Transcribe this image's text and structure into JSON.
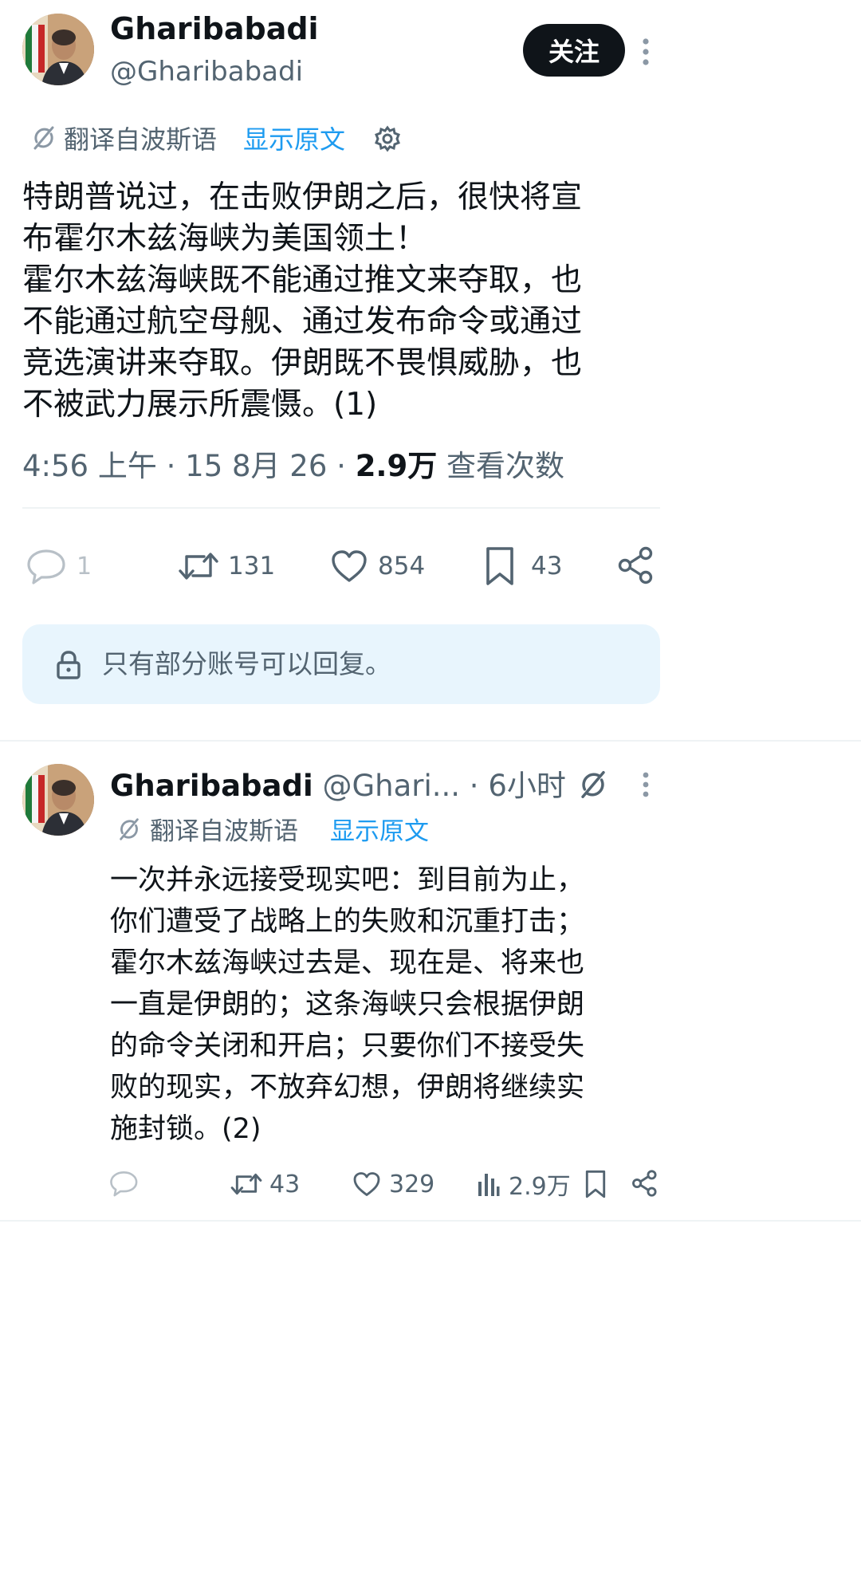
{
  "main_tweet": {
    "display_name": "Gharibabadi",
    "handle": "@Gharibabadi",
    "follow_label": "关注",
    "translate_label": "翻译自波斯语",
    "show_original_label": "显示原文",
    "text": "特朗普说过，在击败伊朗之后，很快将宣\n布霍尔木兹海峡为美国领土！\n霍尔木兹海峡既不能通过推文来夺取，也\n不能通过航空母舰、通过发布命令或通过\n竞选演讲来夺取。伊朗既不畏惧威胁，也\n不被武力展示所震慑。(1)",
    "time": "4:56 上午",
    "dot1": "·",
    "date": "15 8月 26",
    "dot2": "·",
    "views_count": "2.9万",
    "views_label": "查看次数",
    "replies": "1",
    "retweets": "131",
    "likes": "854",
    "bookmarks": "43",
    "reply_restriction": "只有部分账号可以回复。"
  },
  "reply_tweet": {
    "display_name": "Gharibabadi",
    "handle": "@Ghari...",
    "dot": "·",
    "time_ago": "6小时",
    "translate_label": "翻译自波斯语",
    "show_original_label": "显示原文",
    "text": "一次并永远接受现实吧：到目前为止，\n你们遭受了战略上的失败和沉重打击；\n霍尔木兹海峡过去是、现在是、将来也\n一直是伊朗的；这条海峡只会根据伊朗\n的命令关闭和开启；只要你们不接受失\n败的现实，不放弃幻想，伊朗将继续实\n施封锁。(2)",
    "replies": "",
    "retweets": "43",
    "likes": "329",
    "views": "2.9万"
  },
  "icons": [
    "more-icon",
    "translate-icon",
    "settings-gear-icon",
    "reply-icon",
    "retweet-icon",
    "like-icon",
    "bookmark-icon",
    "share-icon",
    "lock-icon",
    "views-icon"
  ],
  "colors": {
    "accent": "#1d9bf0",
    "text": "#0f1419",
    "muted": "#536471",
    "notice_bg": "#e8f5fd",
    "divider": "#eff3f4"
  }
}
